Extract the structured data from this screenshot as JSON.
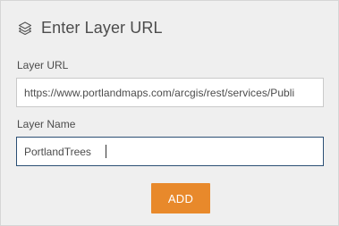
{
  "dialog": {
    "title": "Enter Layer URL",
    "title_icon": "layers-icon"
  },
  "form": {
    "url_label": "Layer URL",
    "url_value": "https://www.portlandmaps.com/arcgis/rest/services/Publi",
    "name_label": "Layer Name",
    "name_value": "PortlandTrees",
    "add_button_label": "ADD"
  },
  "colors": {
    "panel_background": "#efefef",
    "add_button": "#e8892b",
    "focused_border": "#2b4f74",
    "text": "#4c4c4c"
  }
}
